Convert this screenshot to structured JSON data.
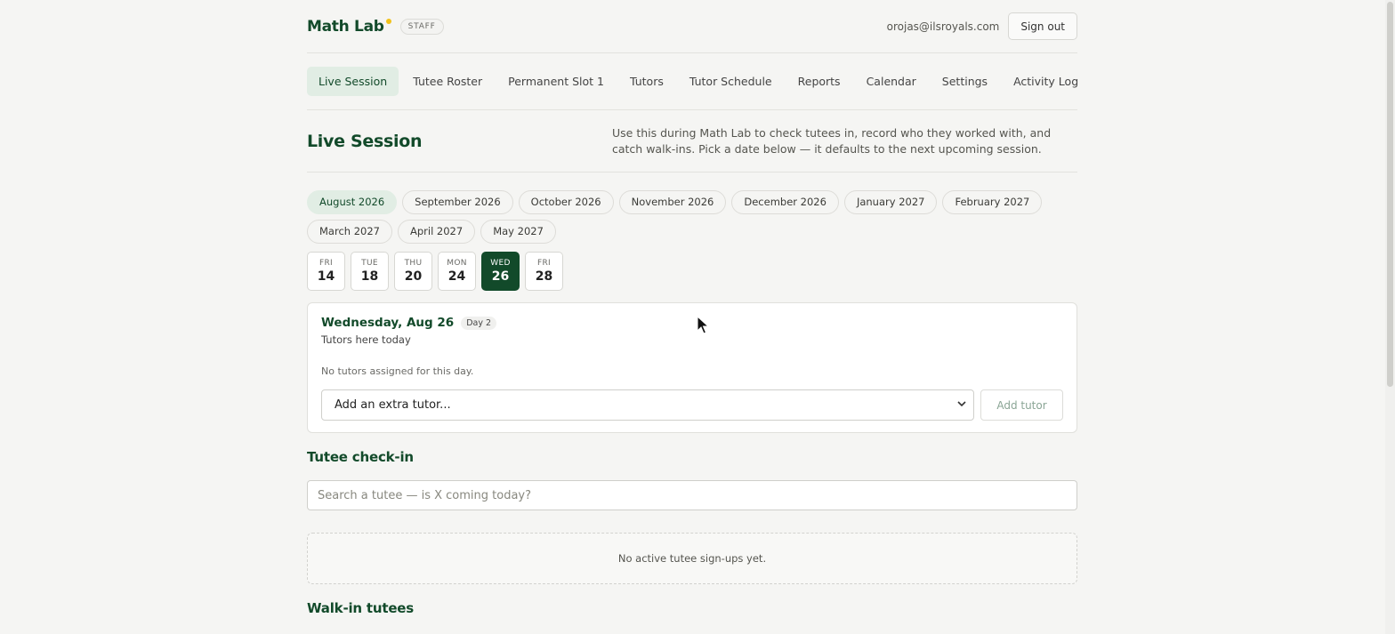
{
  "brand": {
    "name": "Math Lab",
    "role_badge": "STAFF",
    "accent_dot_color": "#f1c21b"
  },
  "user": {
    "email": "orojas@ilsroyals.com",
    "signout_label": "Sign out"
  },
  "nav": {
    "items": [
      {
        "label": "Live Session",
        "active": true
      },
      {
        "label": "Tutee Roster"
      },
      {
        "label": "Permanent Slot 1"
      },
      {
        "label": "Tutors"
      },
      {
        "label": "Tutor Schedule"
      },
      {
        "label": "Reports"
      },
      {
        "label": "Calendar"
      },
      {
        "label": "Settings"
      },
      {
        "label": "Activity Log"
      }
    ]
  },
  "page": {
    "title": "Live Session",
    "description": "Use this during Math Lab to check tutees in, record who they worked with, and catch walk-ins. Pick a date below — it defaults to the next upcoming session."
  },
  "months": [
    {
      "label": "August 2026",
      "active": true
    },
    {
      "label": "September 2026"
    },
    {
      "label": "October 2026"
    },
    {
      "label": "November 2026"
    },
    {
      "label": "December 2026"
    },
    {
      "label": "January 2027"
    },
    {
      "label": "February 2027"
    },
    {
      "label": "March 2027"
    },
    {
      "label": "April 2027"
    },
    {
      "label": "May 2027"
    }
  ],
  "days": [
    {
      "dow": "FRI",
      "num": "14"
    },
    {
      "dow": "TUE",
      "num": "18"
    },
    {
      "dow": "THU",
      "num": "20"
    },
    {
      "dow": "MON",
      "num": "24"
    },
    {
      "dow": "WED",
      "num": "26",
      "active": true
    },
    {
      "dow": "FRI",
      "num": "28"
    }
  ],
  "session": {
    "title": "Wednesday, Aug 26",
    "day_badge": "Day 2",
    "subtitle": "Tutors here today",
    "empty_text": "No tutors assigned for this day.",
    "tutor_select_value": "Add an extra tutor...",
    "add_tutor_label": "Add tutor"
  },
  "checkin": {
    "title": "Tutee check-in",
    "search_placeholder": "Search a tutee — is X coming today?",
    "empty_text": "No active tutee sign-ups yet."
  },
  "walkin": {
    "title": "Walk-in tutees"
  },
  "colors": {
    "primary": "#124a2a",
    "active_bg": "#e1ede4",
    "page_bg": "#f5f5f3"
  }
}
